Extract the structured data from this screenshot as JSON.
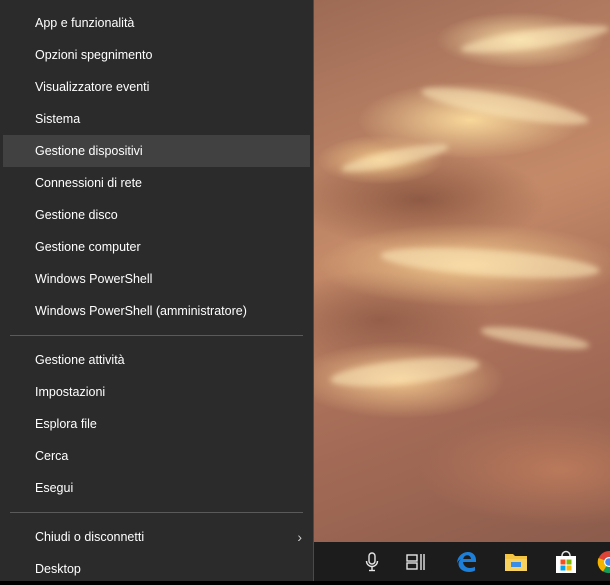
{
  "menu": {
    "items": [
      {
        "label": "App e funzionalità"
      },
      {
        "label": "Opzioni spegnimento"
      },
      {
        "label": "Visualizzatore eventi"
      },
      {
        "label": "Sistema"
      },
      {
        "label": "Gestione dispositivi",
        "highlighted": true
      },
      {
        "label": "Connessioni di rete"
      },
      {
        "label": "Gestione disco"
      },
      {
        "label": "Gestione computer"
      },
      {
        "label": "Windows PowerShell"
      },
      {
        "label": "Windows PowerShell (amministratore)"
      }
    ],
    "items2": [
      {
        "label": "Gestione attività"
      },
      {
        "label": "Impostazioni"
      },
      {
        "label": "Esplora file"
      },
      {
        "label": "Cerca"
      },
      {
        "label": "Esegui"
      }
    ],
    "items3": [
      {
        "label": "Chiudi o disconnetti",
        "has_submenu": true
      },
      {
        "label": "Desktop"
      }
    ]
  },
  "taskbar": {
    "icons": [
      "microphone-icon",
      "task-view-icon",
      "edge-icon",
      "file-explorer-icon",
      "store-icon",
      "chrome-icon"
    ]
  },
  "colors": {
    "menu_bg": "#2b2b2b",
    "menu_hover": "#414141",
    "taskbar_bg": "#1c1c1c",
    "edge_blue": "#1e7fd8",
    "folder_yellow": "#f4c542"
  }
}
